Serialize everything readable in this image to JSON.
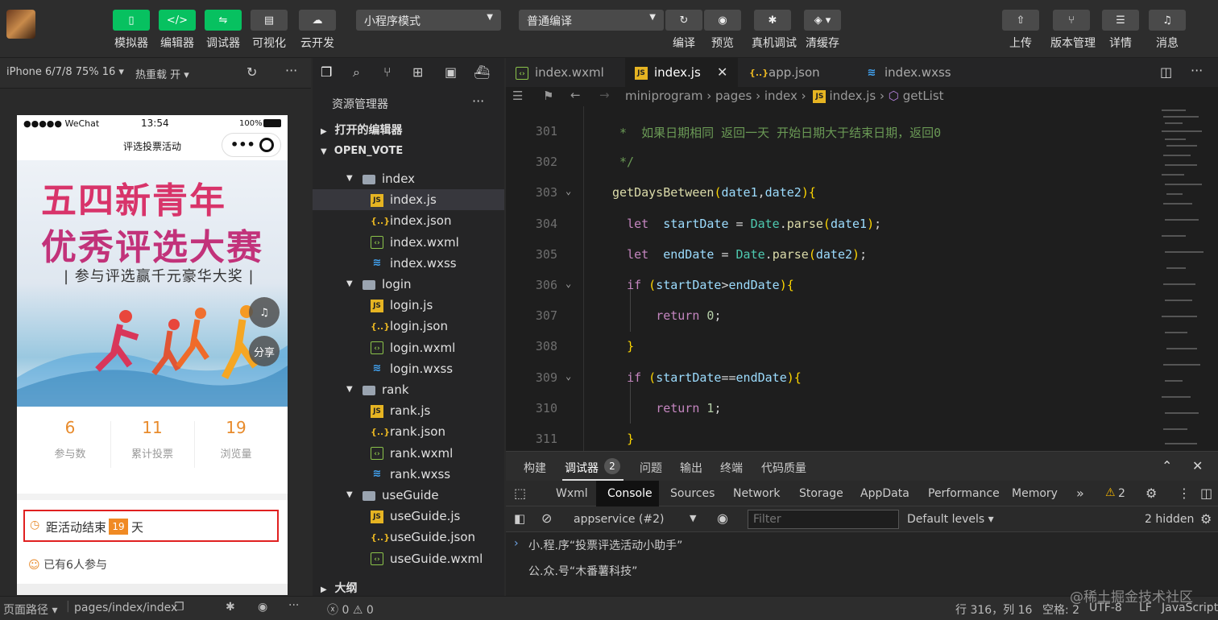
{
  "toolbar": {
    "buttons": [
      {
        "label": "模拟器",
        "icon": "phone-icon"
      },
      {
        "label": "编辑器",
        "icon": "code-icon"
      },
      {
        "label": "调试器",
        "icon": "debug-icon"
      },
      {
        "label": "可视化",
        "icon": "layout-icon"
      },
      {
        "label": "云开发",
        "icon": "cloud-icon"
      }
    ],
    "mode_select": "小程序模式",
    "compile_select": "普通编译",
    "compile_label": "编译",
    "preview_label": "预览",
    "remote_debug_label": "真机调试",
    "clear_cache_label": "清缓存",
    "upload_label": "上传",
    "version_label": "版本管理",
    "details_label": "详情",
    "messages_label": "消息"
  },
  "simulator": {
    "device": "iPhone 6/7/8 75% 16",
    "hot_reload": "热重载 开",
    "status_carrier": "●●●●● WeChat",
    "status_time": "13:54",
    "status_battery": "100%",
    "page_title": "评选投票活动",
    "banner_line1": "五四新青年",
    "banner_line2": "优秀评选大赛",
    "banner_line3": "| 参与评选赢千元豪华大奖 |",
    "share_label": "分享",
    "stats": [
      {
        "value": "6",
        "label": "参与数"
      },
      {
        "value": "11",
        "label": "累计投票"
      },
      {
        "value": "19",
        "label": "浏览量"
      }
    ],
    "countdown_prefix": "距活动结束",
    "countdown_days": "19",
    "countdown_suffix": "天",
    "joined_text": "已有6人参与"
  },
  "explorer": {
    "title": "资源管理器",
    "open_editors": "打开的编辑器",
    "project": "OPEN_VOTE",
    "outline": "大纲",
    "items": [
      {
        "name": "index",
        "type": "folder",
        "depth": 1
      },
      {
        "name": "index.js",
        "type": "js",
        "depth": 2,
        "selected": true
      },
      {
        "name": "index.json",
        "type": "json",
        "depth": 2
      },
      {
        "name": "index.wxml",
        "type": "wxml",
        "depth": 2
      },
      {
        "name": "index.wxss",
        "type": "wxss",
        "depth": 2
      },
      {
        "name": "login",
        "type": "folder",
        "depth": 1
      },
      {
        "name": "login.js",
        "type": "js",
        "depth": 2
      },
      {
        "name": "login.json",
        "type": "json",
        "depth": 2
      },
      {
        "name": "login.wxml",
        "type": "wxml",
        "depth": 2
      },
      {
        "name": "login.wxss",
        "type": "wxss",
        "depth": 2
      },
      {
        "name": "rank",
        "type": "folder",
        "depth": 1
      },
      {
        "name": "rank.js",
        "type": "js",
        "depth": 2
      },
      {
        "name": "rank.json",
        "type": "json",
        "depth": 2
      },
      {
        "name": "rank.wxml",
        "type": "wxml",
        "depth": 2
      },
      {
        "name": "rank.wxss",
        "type": "wxss",
        "depth": 2
      },
      {
        "name": "useGuide",
        "type": "folder",
        "depth": 1
      },
      {
        "name": "useGuide.js",
        "type": "js",
        "depth": 2
      },
      {
        "name": "useGuide.json",
        "type": "json",
        "depth": 2
      },
      {
        "name": "useGuide.wxml",
        "type": "wxml",
        "depth": 2
      }
    ]
  },
  "editor": {
    "tabs": [
      {
        "label": "index.wxml",
        "type": "wxml"
      },
      {
        "label": "index.js",
        "type": "js",
        "active": true
      },
      {
        "label": "app.json",
        "type": "json"
      },
      {
        "label": "index.wxss",
        "type": "wxss"
      }
    ],
    "breadcrumb": [
      "miniprogram",
      "pages",
      "index",
      "index.js",
      "getList"
    ],
    "lines": [
      {
        "n": "301",
        "text": " *  如果日期相同 返回一天 开始日期大于结束日期，返回0"
      },
      {
        "n": "302",
        "text": " */"
      },
      {
        "n": "303",
        "text": "getDaysBetween(date1,date2){"
      },
      {
        "n": "304",
        "text": "  let  startDate = Date.parse(date1);"
      },
      {
        "n": "305",
        "text": "  let  endDate = Date.parse(date2);"
      },
      {
        "n": "306",
        "text": "  if (startDate>endDate){"
      },
      {
        "n": "307",
        "text": "      return 0;"
      },
      {
        "n": "308",
        "text": "  }"
      },
      {
        "n": "309",
        "text": "  if (startDate==endDate){"
      },
      {
        "n": "310",
        "text": "      return 1;"
      },
      {
        "n": "311",
        "text": "  }"
      }
    ]
  },
  "devtools": {
    "top_tabs": [
      "构建",
      "调试器",
      "问题",
      "输出",
      "终端",
      "代码质量"
    ],
    "debugger_badge": "2",
    "panels": [
      "Wxml",
      "Console",
      "Sources",
      "Network",
      "Storage",
      "AppData",
      "Performance",
      "Memory"
    ],
    "warn_count": "2",
    "context": "appservice (#2)",
    "filter_placeholder": "Filter",
    "levels": "Default levels",
    "hidden": "2 hidden",
    "console_lines": [
      "小.程.序“投票评选活动小助手”",
      "公.众.号“木番薯科技”"
    ]
  },
  "statusbar": {
    "page_path_label": "页面路径",
    "page_path": "pages/index/index",
    "errors": "0",
    "warnings": "0",
    "cursor": "行 316，列 16",
    "spaces": "空格: 2",
    "encoding": "UTF-8",
    "eol": "LF",
    "language": "JavaScript",
    "watermark": "@稀土掘金技术社区"
  }
}
